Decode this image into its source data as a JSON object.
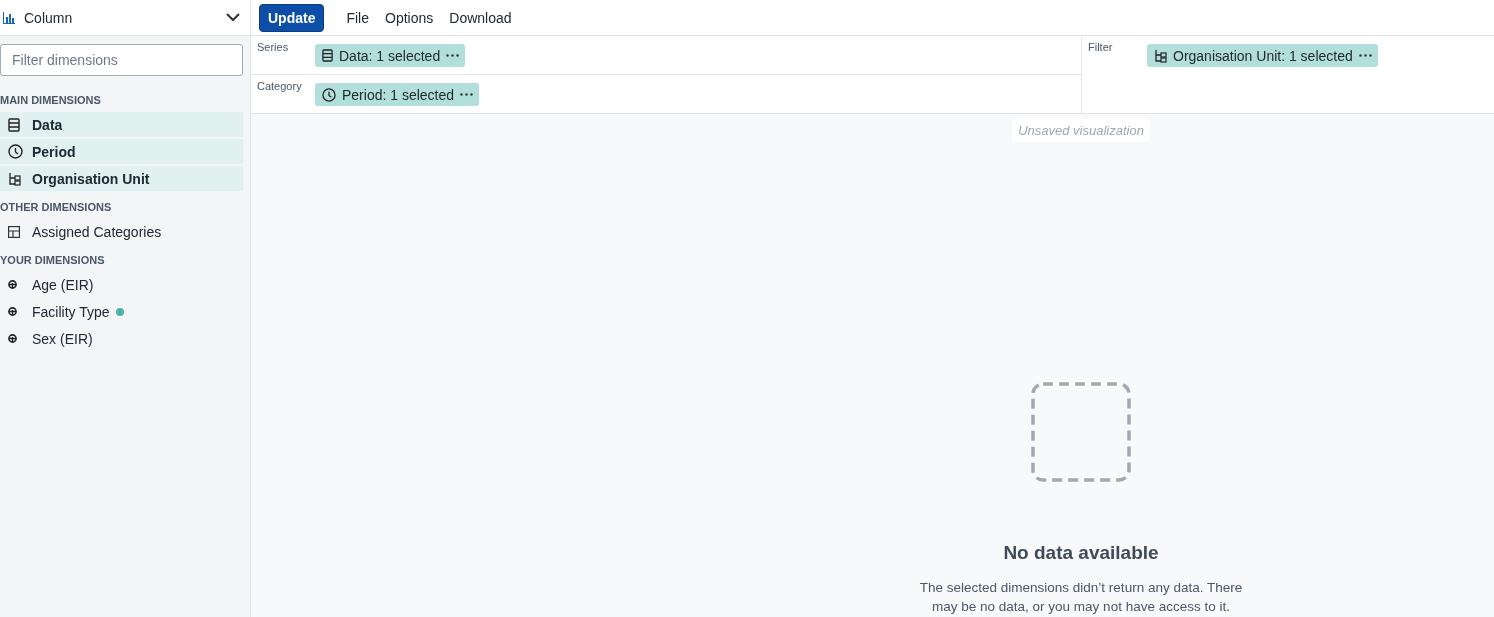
{
  "chart_type": {
    "label": "Column"
  },
  "menu": {
    "update": "Update",
    "items": [
      "File",
      "Options",
      "Download"
    ]
  },
  "sidebar": {
    "filter": {
      "placeholder": "Filter dimensions"
    },
    "sections": [
      {
        "title": "MAIN DIMENSIONS",
        "items": [
          {
            "label": "Data",
            "kind": "data",
            "selected": true
          },
          {
            "label": "Period",
            "kind": "period",
            "selected": true
          },
          {
            "label": "Organisation Unit",
            "kind": "orgunit",
            "selected": true
          }
        ]
      },
      {
        "title": "OTHER DIMENSIONS",
        "items": [
          {
            "label": "Assigned Categories",
            "kind": "table",
            "selected": false
          }
        ]
      },
      {
        "title": "YOUR DIMENSIONS",
        "items": [
          {
            "label": "Age (EIR)",
            "kind": "dimension",
            "selected": false
          },
          {
            "label": "Facility Type",
            "kind": "dimension",
            "selected": false,
            "color": "#48b5a4"
          },
          {
            "label": "Sex (EIR)",
            "kind": "dimension",
            "selected": false
          }
        ]
      }
    ]
  },
  "layout": {
    "axes": [
      {
        "label": "Series",
        "chips": [
          {
            "text": "Data: 1 selected",
            "kind": "data"
          }
        ]
      },
      {
        "label": "Category",
        "chips": [
          {
            "text": "Period: 1 selected",
            "kind": "period"
          }
        ]
      }
    ],
    "filter": {
      "label": "Filter",
      "chips": [
        {
          "text": "Organisation Unit: 1 selected",
          "kind": "orgunit"
        }
      ]
    }
  },
  "canvas": {
    "title": "Unsaved visualization",
    "empty": {
      "heading": "No data available",
      "message": "The selected dimensions didn’t return any data. There may be no data, or you may not have access to it."
    }
  }
}
